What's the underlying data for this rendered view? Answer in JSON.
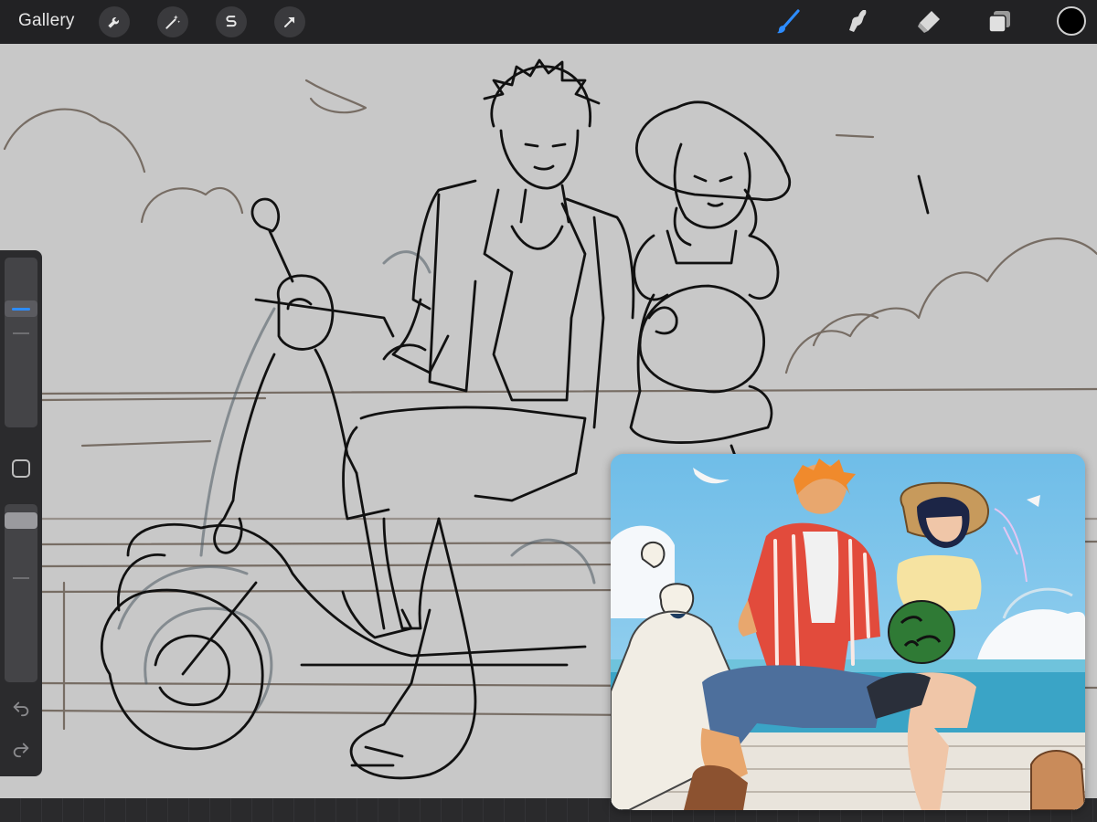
{
  "topbar": {
    "gallery_label": "Gallery",
    "left_tools": [
      {
        "name": "wrench-icon",
        "purpose": "actions"
      },
      {
        "name": "magic-wand-icon",
        "purpose": "adjustments"
      },
      {
        "name": "selection-s-icon",
        "purpose": "selection"
      },
      {
        "name": "arrow-cursor-icon",
        "purpose": "transform"
      }
    ],
    "right_tools": [
      {
        "name": "brush-icon",
        "active": true
      },
      {
        "name": "smudge-icon",
        "active": false
      },
      {
        "name": "eraser-icon",
        "active": false
      },
      {
        "name": "layers-icon",
        "active": false
      }
    ],
    "current_color": "#000000"
  },
  "sidebar": {
    "brush_size_level": 0.72,
    "opacity_level": 0.95
  },
  "colors": {
    "accent": "#2d8cff",
    "canvas": "#c8c8c8",
    "toolbar": "#222224"
  }
}
